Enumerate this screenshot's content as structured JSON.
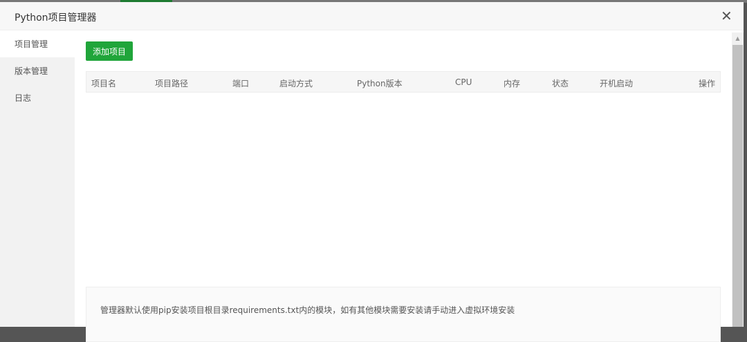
{
  "modal": {
    "title": "Python项目管理器"
  },
  "sidebar": {
    "items": [
      {
        "label": "项目管理"
      },
      {
        "label": "版本管理"
      },
      {
        "label": "日志"
      }
    ]
  },
  "toolbar": {
    "add_label": "添加项目"
  },
  "table": {
    "columns": [
      "项目名",
      "项目路径",
      "端口",
      "启动方式",
      "Python版本",
      "CPU",
      "内存",
      "状态",
      "开机启动",
      "操作"
    ]
  },
  "notice": {
    "text": "管理器默认使用pip安装项目根目录requirements.txt内的模块，如有其他模块需要安装请手动进入虚拟环境安装"
  }
}
